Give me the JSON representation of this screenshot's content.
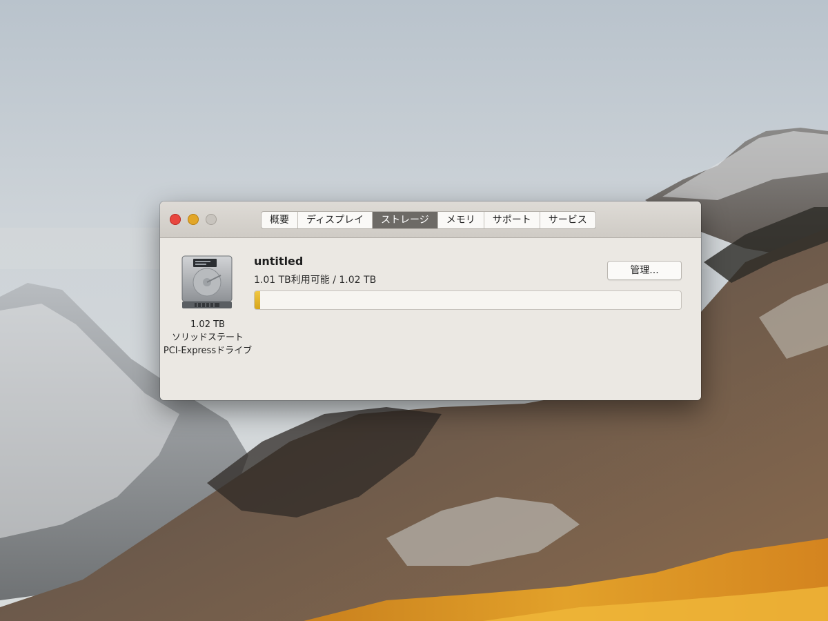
{
  "desktop": {
    "wallpaper": "macOS High Sierra mountain landscape"
  },
  "window": {
    "tabs": [
      {
        "label": "概要",
        "active": false
      },
      {
        "label": "ディスプレイ",
        "active": false
      },
      {
        "label": "ストレージ",
        "active": true
      },
      {
        "label": "メモリ",
        "active": false
      },
      {
        "label": "サポート",
        "active": false
      },
      {
        "label": "サービス",
        "active": false
      }
    ],
    "colors": {
      "close": "#e8463f",
      "minimize": "#e2a628",
      "zoom": "#c8c4be",
      "active_tab": "#6d6a66",
      "used_bar": "#e0b22a"
    }
  },
  "storage": {
    "drive_icon": "hard-drive-icon",
    "drive_capacity": "1.02 TB",
    "drive_type_line1": "ソリッドステート",
    "drive_type_line2": "PCI-Expressドライブ",
    "volume_name": "untitled",
    "capacity_text": "1.01 TB利用可能 / 1.02 TB",
    "manage_label": "管理...",
    "used_fraction": 0.01
  }
}
